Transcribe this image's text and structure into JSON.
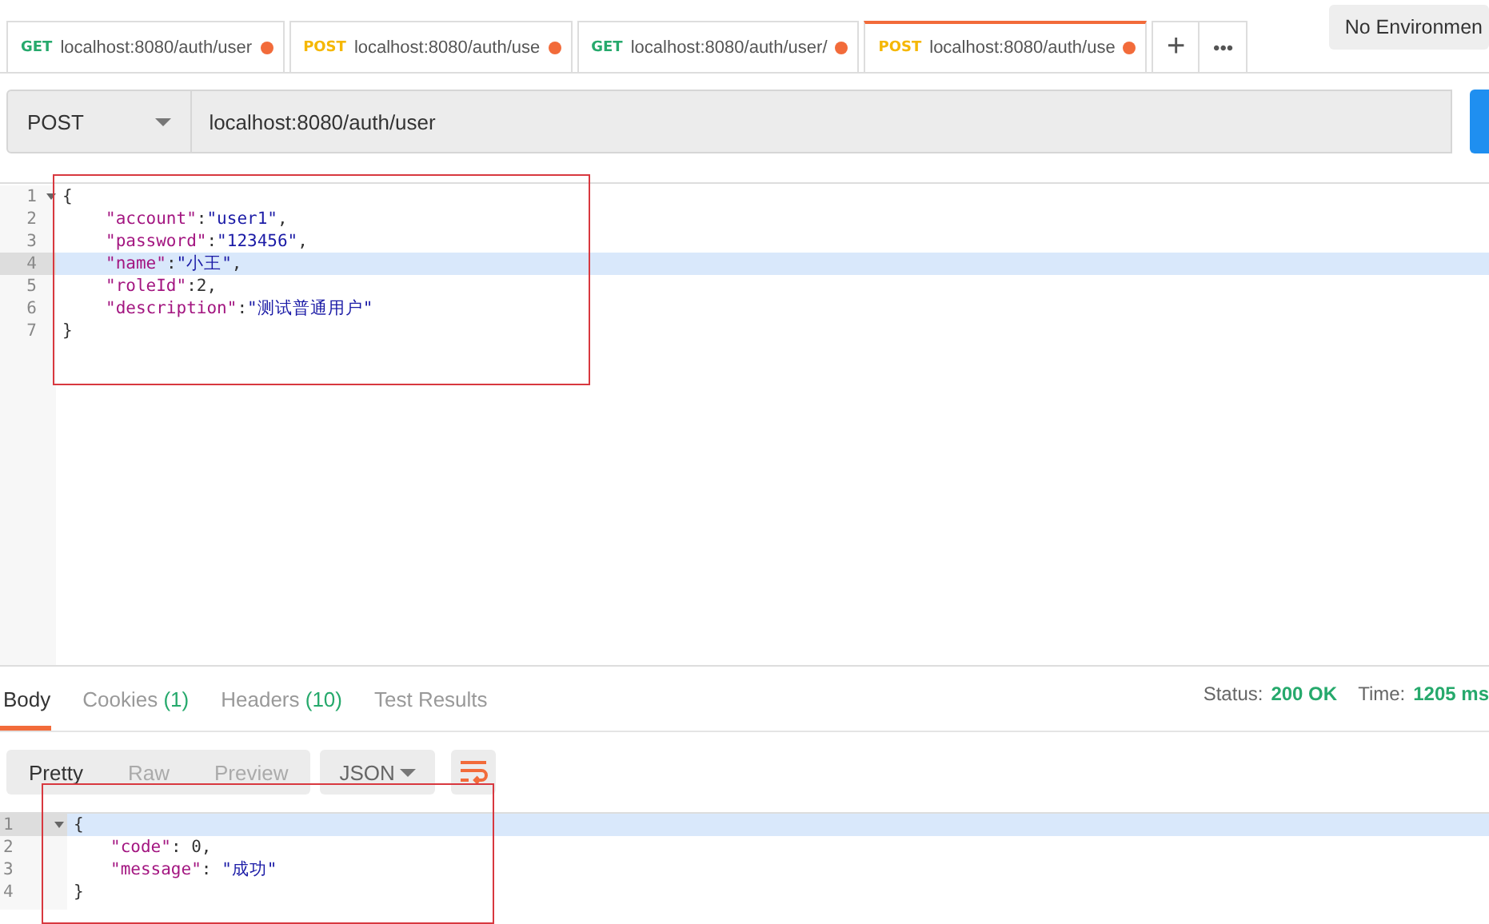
{
  "tabs": [
    {
      "method": "GET",
      "color": "#26a96c",
      "url": "localhost:8080/auth/user",
      "unsaved": true,
      "selected": false
    },
    {
      "method": "POST",
      "color": "#f5b700",
      "url": "localhost:8080/auth/use",
      "unsaved": true,
      "selected": false
    },
    {
      "method": "GET",
      "color": "#26a96c",
      "url": "localhost:8080/auth/user/",
      "unsaved": true,
      "selected": false
    },
    {
      "method": "POST",
      "color": "#f5b700",
      "url": "localhost:8080/auth/use",
      "unsaved": true,
      "selected": true
    }
  ],
  "new_tab": "+",
  "more_tabs": "•••",
  "environment": "No Environmen",
  "request": {
    "method": "POST",
    "url": "localhost:8080/auth/user"
  },
  "body_editor": {
    "lines": [
      {
        "number": "1",
        "foldable": true,
        "active": false,
        "tokens": [
          {
            "kind": "punct",
            "text": "{"
          }
        ]
      },
      {
        "number": "2",
        "foldable": false,
        "active": false,
        "tokens": [
          {
            "kind": "key",
            "text": "\"account\""
          },
          {
            "kind": "punct",
            "text": ":"
          },
          {
            "kind": "string",
            "text": "\"user1\""
          },
          {
            "kind": "punct",
            "text": ","
          }
        ]
      },
      {
        "number": "3",
        "foldable": false,
        "active": false,
        "tokens": [
          {
            "kind": "key",
            "text": "\"password\""
          },
          {
            "kind": "punct",
            "text": ":"
          },
          {
            "kind": "string",
            "text": "\"123456\""
          },
          {
            "kind": "punct",
            "text": ","
          }
        ]
      },
      {
        "number": "4",
        "foldable": false,
        "active": true,
        "tokens": [
          {
            "kind": "key",
            "text": "\"name\""
          },
          {
            "kind": "punct",
            "text": ":"
          },
          {
            "kind": "string",
            "text": "\"小王\""
          },
          {
            "kind": "punct",
            "text": ","
          }
        ]
      },
      {
        "number": "5",
        "foldable": false,
        "active": false,
        "tokens": [
          {
            "kind": "key",
            "text": "\"roleId\""
          },
          {
            "kind": "punct",
            "text": ":"
          },
          {
            "kind": "number",
            "text": "2"
          },
          {
            "kind": "punct",
            "text": ","
          }
        ]
      },
      {
        "number": "6",
        "foldable": false,
        "active": false,
        "tokens": [
          {
            "kind": "key",
            "text": "\"description\""
          },
          {
            "kind": "punct",
            "text": ":"
          },
          {
            "kind": "string",
            "text": "\"测试普通用户\""
          }
        ]
      },
      {
        "number": "7",
        "foldable": false,
        "active": false,
        "tokens": [
          {
            "kind": "punct",
            "text": "}"
          }
        ]
      }
    ]
  },
  "response_tabs": [
    {
      "label": "Body",
      "selected": true
    },
    {
      "label": "Cookies",
      "count": "(1)",
      "selected": false
    },
    {
      "label": "Headers",
      "count": "(10)",
      "selected": false
    },
    {
      "label": "Test Results",
      "selected": false
    }
  ],
  "status": {
    "status_label": "Status:",
    "status_value": "200 OK",
    "time_label": "Time:",
    "time_value": "1205 ms"
  },
  "view_modes": [
    {
      "label": "Pretty",
      "selected": true
    },
    {
      "label": "Raw",
      "selected": false
    },
    {
      "label": "Preview",
      "selected": false
    }
  ],
  "format": "JSON",
  "response_editor": {
    "lines": [
      {
        "number": "1",
        "foldable": true,
        "active": true,
        "tokens": [
          {
            "kind": "punct",
            "text": "{"
          }
        ]
      },
      {
        "number": "2",
        "foldable": false,
        "active": false,
        "tokens": [
          {
            "kind": "key",
            "text": "\"code\""
          },
          {
            "kind": "punct",
            "text": ": "
          },
          {
            "kind": "number",
            "text": "0"
          },
          {
            "kind": "punct",
            "text": ","
          }
        ]
      },
      {
        "number": "3",
        "foldable": false,
        "active": false,
        "tokens": [
          {
            "kind": "key",
            "text": "\"message\""
          },
          {
            "kind": "punct",
            "text": ": "
          },
          {
            "kind": "string",
            "text": "\"成功\""
          }
        ]
      },
      {
        "number": "4",
        "foldable": false,
        "active": false,
        "tokens": [
          {
            "kind": "punct",
            "text": "}"
          }
        ]
      }
    ]
  }
}
